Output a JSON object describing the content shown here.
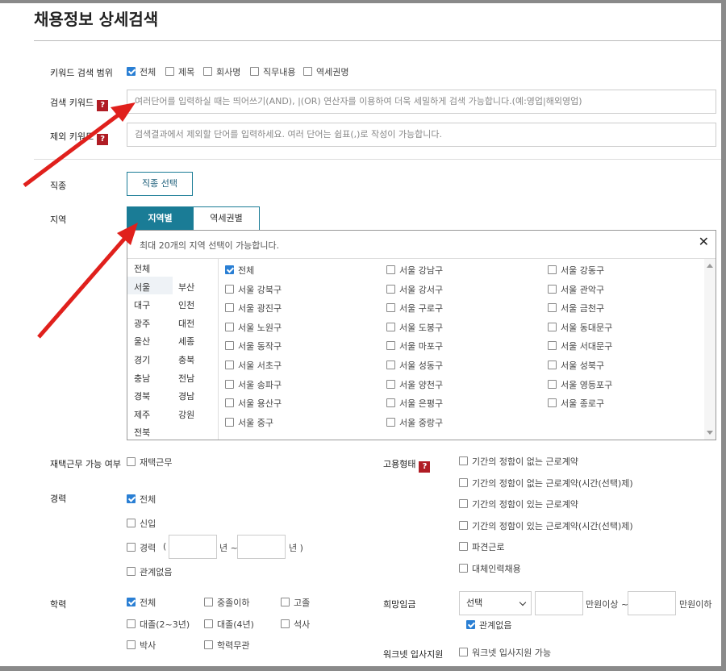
{
  "page_title": "채용정보 상세검색",
  "keyword_scope": {
    "label": "키워드 검색 범위",
    "options": [
      {
        "label": "전체",
        "checked": true
      },
      {
        "label": "제목",
        "checked": false
      },
      {
        "label": "회사명",
        "checked": false
      },
      {
        "label": "직무내용",
        "checked": false
      },
      {
        "label": "역세권명",
        "checked": false
      }
    ]
  },
  "search_keyword": {
    "label": "검색 키워드",
    "help": "?",
    "placeholder": "여러단어를 입력하실 때는 띄어쓰기(AND), |(OR) 연산자를 이용하여 더욱 세밀하게 검색 가능합니다.(예:영업|해외영업)"
  },
  "exclude_keyword": {
    "label": "제외 키워드",
    "help": "?",
    "placeholder": "검색결과에서 제외할 단어를 입력하세요. 여러 단어는 쉼표(,)로 작성이 가능합니다."
  },
  "job_type": {
    "label": "직종",
    "button": "직종 선택"
  },
  "region": {
    "label": "지역",
    "tabs": [
      "지역별",
      "역세권별"
    ],
    "notice": "최대 20개의 지역 선택이 가능합니다.",
    "close": "✕",
    "left_list": [
      [
        "전체",
        ""
      ],
      [
        "서울",
        "부산"
      ],
      [
        "대구",
        "인천"
      ],
      [
        "광주",
        "대전"
      ],
      [
        "울산",
        "세종"
      ],
      [
        "경기",
        "충북"
      ],
      [
        "충남",
        "전남"
      ],
      [
        "경북",
        "경남"
      ],
      [
        "제주",
        "강원"
      ],
      [
        "전북",
        ""
      ]
    ],
    "districts": [
      [
        {
          "label": "전체",
          "checked": true
        },
        {
          "label": "서울 강남구",
          "checked": false
        },
        {
          "label": "서울 강동구",
          "checked": false
        }
      ],
      [
        {
          "label": "서울 강북구",
          "checked": false
        },
        {
          "label": "서울 강서구",
          "checked": false
        },
        {
          "label": "서울 관악구",
          "checked": false
        }
      ],
      [
        {
          "label": "서울 광진구",
          "checked": false
        },
        {
          "label": "서울 구로구",
          "checked": false
        },
        {
          "label": "서울 금천구",
          "checked": false
        }
      ],
      [
        {
          "label": "서울 노원구",
          "checked": false
        },
        {
          "label": "서울 도봉구",
          "checked": false
        },
        {
          "label": "서울 동대문구",
          "checked": false
        }
      ],
      [
        {
          "label": "서울 동작구",
          "checked": false
        },
        {
          "label": "서울 마포구",
          "checked": false
        },
        {
          "label": "서울 서대문구",
          "checked": false
        }
      ],
      [
        {
          "label": "서울 서초구",
          "checked": false
        },
        {
          "label": "서울 성동구",
          "checked": false
        },
        {
          "label": "서울 성북구",
          "checked": false
        }
      ],
      [
        {
          "label": "서울 송파구",
          "checked": false
        },
        {
          "label": "서울 양천구",
          "checked": false
        },
        {
          "label": "서울 영등포구",
          "checked": false
        }
      ],
      [
        {
          "label": "서울 용산구",
          "checked": false
        },
        {
          "label": "서울 은평구",
          "checked": false
        },
        {
          "label": "서울 종로구",
          "checked": false
        }
      ],
      [
        {
          "label": "서울 중구",
          "checked": false
        },
        {
          "label": "서울 중랑구",
          "checked": false
        }
      ]
    ]
  },
  "remote": {
    "label": "재택근무 가능 여부",
    "option": "재택근무"
  },
  "employment": {
    "label": "고용형태",
    "help": "?",
    "options": [
      "기간의 정함이 없는 근로계약",
      "기간의 정함이 없는 근로계약(시간(선택)제)",
      "기간의 정함이 있는 근로계약",
      "기간의 정함이 있는 근로계약(시간(선택)제)",
      "파견근로",
      "대체인력채용"
    ]
  },
  "career": {
    "label": "경력",
    "all": "전체",
    "new": "신입",
    "experienced": "경력",
    "paren_open": "(",
    "year_unit": "년 ~",
    "year_unit2": "년 )",
    "none": "관계없음"
  },
  "education": {
    "label": "학력",
    "options": [
      {
        "label": "전체",
        "checked": true
      },
      {
        "label": "중졸이하",
        "checked": false
      },
      {
        "label": "고졸",
        "checked": false
      },
      {
        "label": "대졸(2~3년)",
        "checked": false
      },
      {
        "label": "대졸(4년)",
        "checked": false
      },
      {
        "label": "석사",
        "checked": false
      },
      {
        "label": "박사",
        "checked": false
      },
      {
        "label": "학력무관",
        "checked": false
      }
    ]
  },
  "salary": {
    "label": "희망임금",
    "select": "선택",
    "min_unit": "만원이상 ~",
    "max_unit": "만원이하",
    "none": "관계없음"
  },
  "worknet": {
    "label": "워크넷 입사지원",
    "option": "워크넷 입사지원 가능"
  },
  "colors": {
    "accent": "#1a7c96",
    "help": "#b01c24",
    "arrow": "#e0201c",
    "check": "#2a7fd4"
  }
}
